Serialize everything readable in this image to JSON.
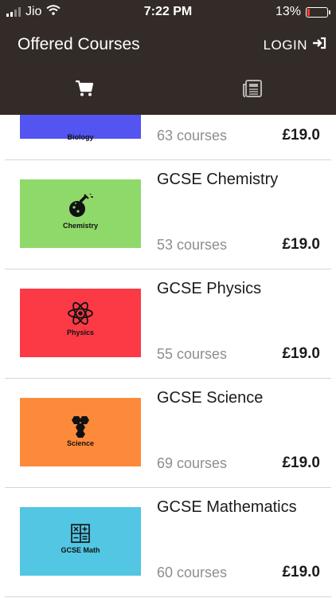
{
  "status": {
    "carrier": "Jio",
    "time": "7:22 PM",
    "battery": "13%",
    "battery_level": 0.13
  },
  "header": {
    "title": "Offered Courses",
    "login": "LOGIN"
  },
  "tabs": [
    {
      "icon": "cart-icon",
      "active": true
    },
    {
      "icon": "newspaper-icon",
      "active": false
    }
  ],
  "courses": [
    {
      "thumb_label": "Biology",
      "thumb_color": "#5454f0",
      "title": "",
      "count": "63 courses",
      "price": "£19.0"
    },
    {
      "thumb_label": "Chemistry",
      "thumb_color": "#8fd96a",
      "title": "GCSE Chemistry",
      "count": "53 courses",
      "price": "£19.0"
    },
    {
      "thumb_label": "Physics",
      "thumb_color": "#fb3a45",
      "title": "GCSE Physics",
      "count": "55 courses",
      "price": "£19.0"
    },
    {
      "thumb_label": "Science",
      "thumb_color": "#fd8a3a",
      "title": "GCSE Science",
      "count": "69 courses",
      "price": "£19.0"
    },
    {
      "thumb_label": "GCSE Math",
      "thumb_color": "#52c6e3",
      "title": "GCSE Mathematics",
      "count": "60 courses",
      "price": "£19.0"
    }
  ]
}
